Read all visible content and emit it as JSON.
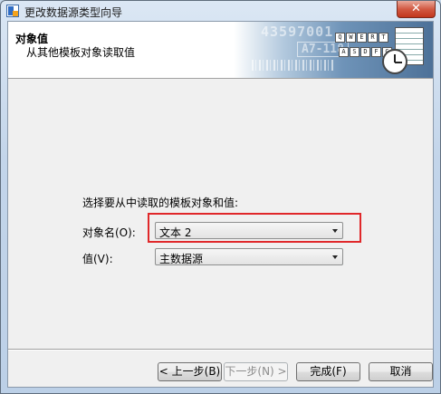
{
  "window": {
    "title": "更改数据源类型向导",
    "close_label": "✕"
  },
  "header": {
    "title": "对象值",
    "subtitle": "从其他模板对象读取值",
    "banner_number": "43597001",
    "banner_code": "A7-118",
    "banner_keys_row1": [
      "Q",
      "W",
      "E",
      "R",
      "T"
    ],
    "banner_keys_row2": [
      "A",
      "S",
      "D",
      "F",
      "G"
    ]
  },
  "form": {
    "instruction": "选择要从中读取的模板对象和值:",
    "object_label": "对象名(O):",
    "object_value": "文本 2",
    "value_label": "值(V):",
    "value_value": "主数据源"
  },
  "buttons": {
    "back": "< 上一步(B)",
    "next": "下一步(N) >",
    "finish": "完成(F)",
    "cancel": "取消"
  },
  "colors": {
    "highlight": "#e0282a",
    "banner_dark": "#4d7198"
  }
}
